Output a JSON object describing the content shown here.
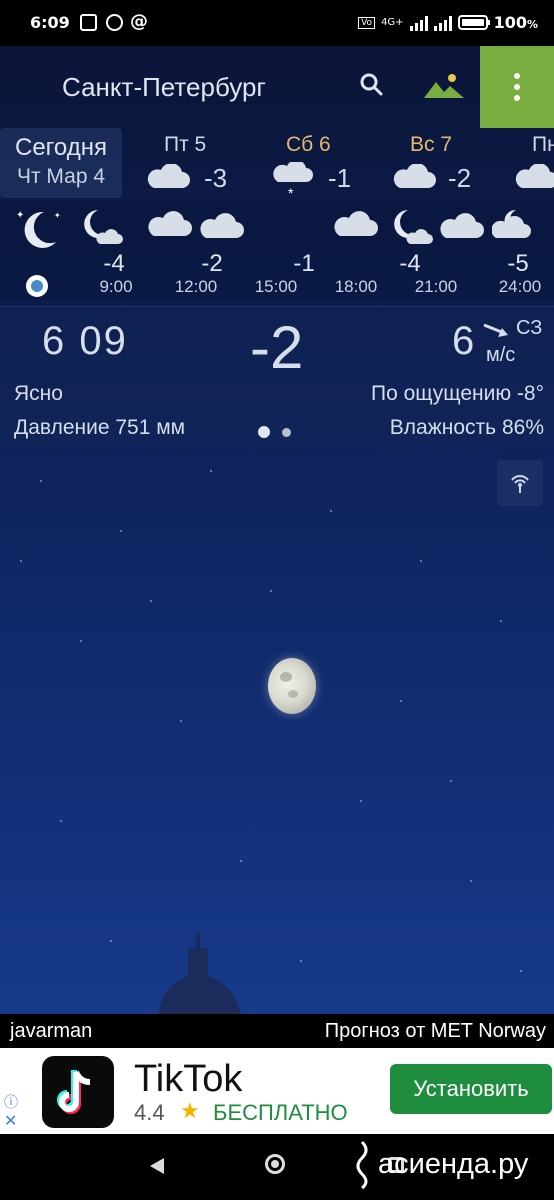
{
  "status_bar": {
    "time": "6:09",
    "battery": "100",
    "network": "4G+"
  },
  "toolbar": {
    "city": "Санкт-Петербург"
  },
  "today": {
    "label": "Сегодня",
    "date": "Чт Мар 4"
  },
  "days": [
    {
      "name": "Пт 5",
      "temp": "-3",
      "icon": "cloud-icon",
      "weekend": false
    },
    {
      "name": "Сб 6",
      "temp": "-1",
      "icon": "snow-cloud-icon",
      "weekend": true
    },
    {
      "name": "Вс 7",
      "temp": "-2",
      "icon": "cloud-icon",
      "weekend": true
    },
    {
      "name": "Пн",
      "temp": "",
      "icon": "cloud-icon",
      "weekend": false
    }
  ],
  "hourly": [
    {
      "time": "9:00",
      "temp": "-4"
    },
    {
      "time": "12:00",
      "temp": "-2"
    },
    {
      "time": "15:00",
      "temp": "-1"
    },
    {
      "time": "18:00",
      "temp": "-4"
    },
    {
      "time": "21:00",
      "temp": "-5"
    },
    {
      "time": "24:00",
      "temp": ""
    }
  ],
  "current": {
    "time": "6 09",
    "temp": "-2",
    "wind_speed": "6",
    "wind_dir": "СЗ",
    "wind_unit": "м/с",
    "condition": "Ясно",
    "feels_like": "По ощущению -8°",
    "pressure": "Давление 751 мм",
    "humidity": "Влажность 86%"
  },
  "credits": {
    "author": "javarman",
    "source": "Прогноз от MET Norway"
  },
  "ad": {
    "title": "TikTok",
    "rating": "4.4",
    "star": "★",
    "price": "БЕСПЛАТНО",
    "install": "Установить",
    "info": "ⓘ",
    "close": "✕"
  },
  "watermark": "асиенда.ру",
  "colors": {
    "menu_accent": "#7aad3f",
    "weekend": "#e8b86a",
    "install": "#1e8e3e"
  }
}
